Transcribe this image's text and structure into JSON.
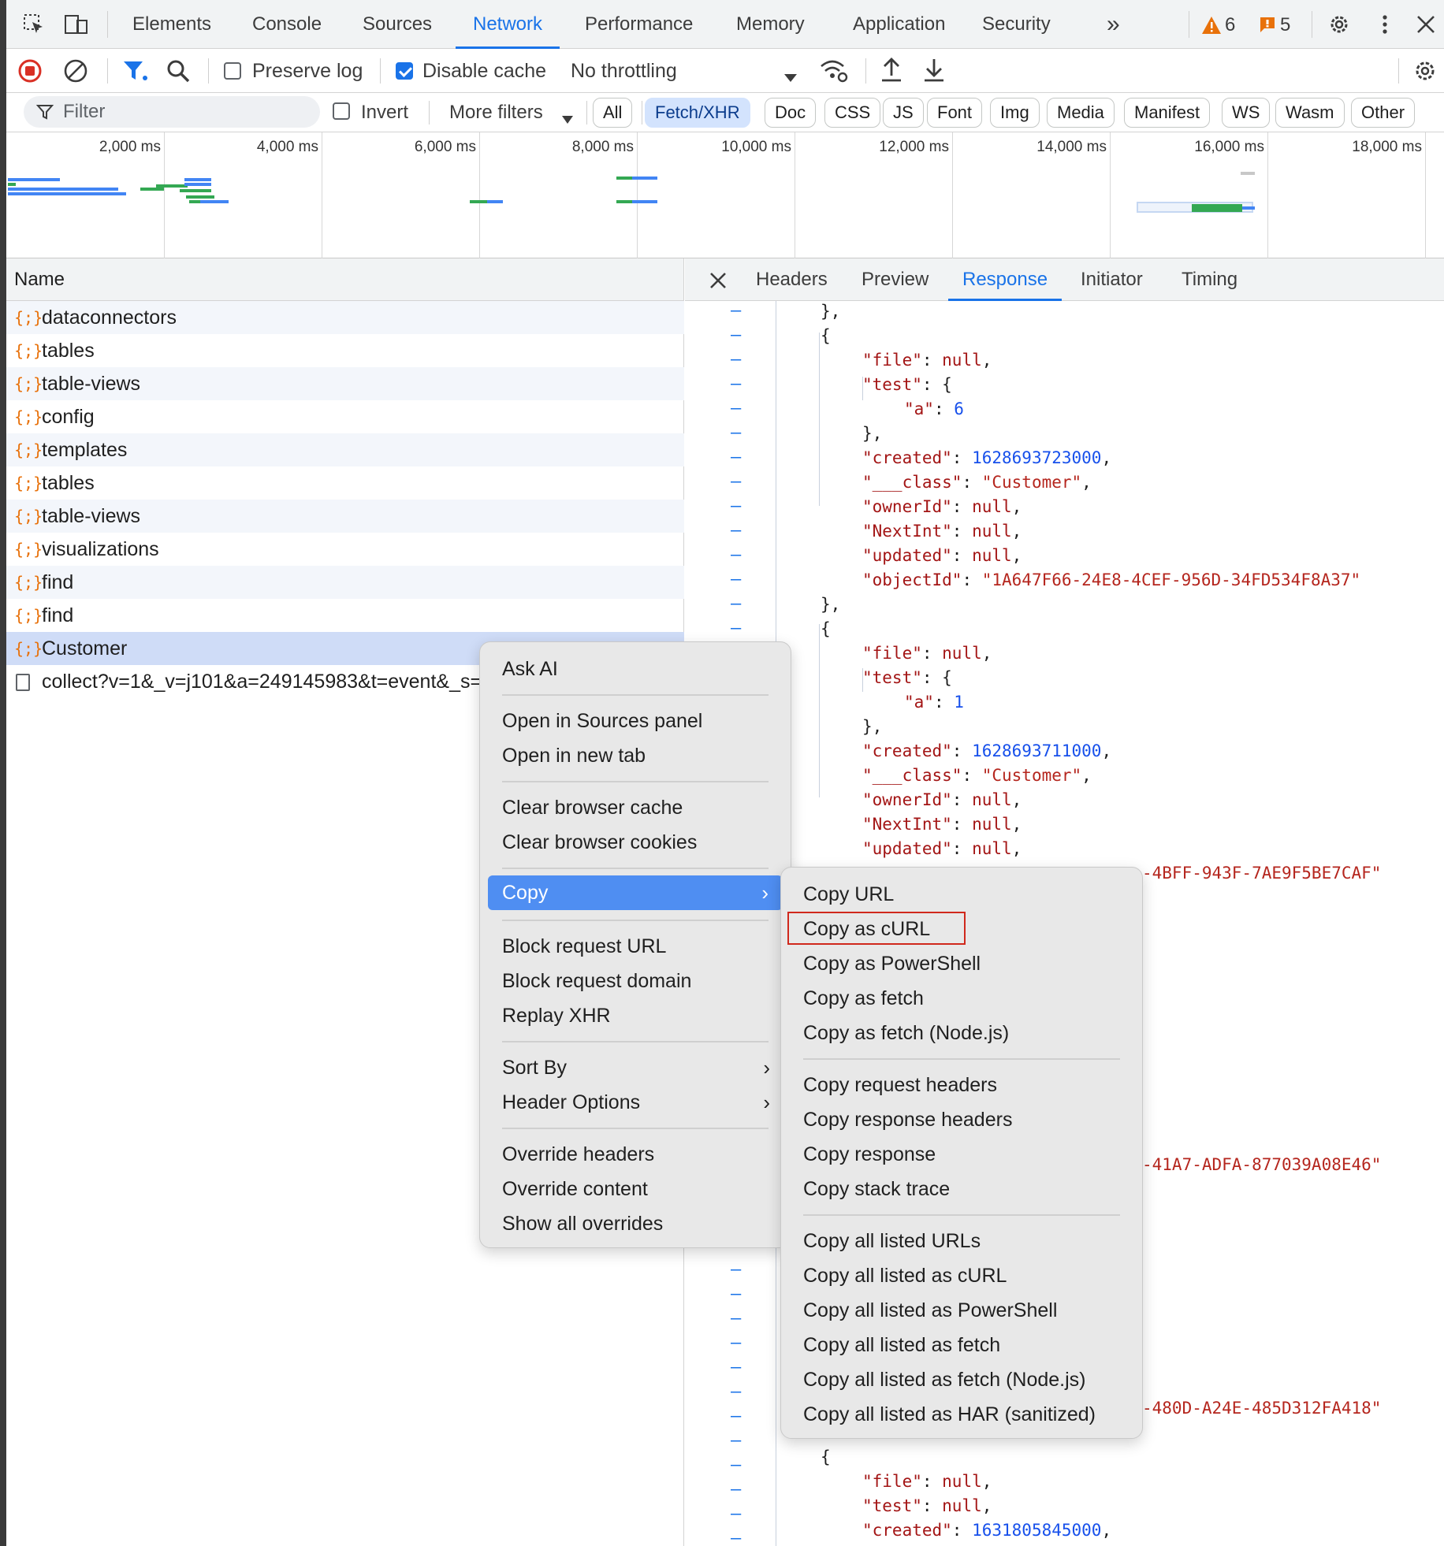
{
  "topbar": {
    "tabs": [
      "Elements",
      "Console",
      "Sources",
      "Network",
      "Performance",
      "Memory",
      "Application",
      "Security"
    ],
    "active_tab": "Network",
    "more_tabs": "»",
    "warnings_count": "6",
    "issues_count": "5"
  },
  "toolbar": {
    "preserve_log": "Preserve log",
    "preserve_log_checked": false,
    "disable_cache": "Disable cache",
    "disable_cache_checked": true,
    "throttling": "No throttling"
  },
  "filter": {
    "placeholder": "Filter",
    "invert": "Invert",
    "more_filters": "More filters",
    "types": [
      "All",
      "Fetch/XHR",
      "Doc",
      "CSS",
      "JS",
      "Font",
      "Img",
      "Media",
      "Manifest",
      "WS",
      "Wasm",
      "Other"
    ],
    "active_type": "Fetch/XHR"
  },
  "overview": {
    "ticks": [
      "2,000 ms",
      "4,000 ms",
      "6,000 ms",
      "8,000 ms",
      "10,000 ms",
      "12,000 ms",
      "14,000 ms",
      "16,000 ms",
      "18,000 ms"
    ]
  },
  "requests": {
    "header": "Name",
    "rows": [
      {
        "name": "dataconnectors",
        "type": "xhr"
      },
      {
        "name": "tables",
        "type": "xhr"
      },
      {
        "name": "table-views",
        "type": "xhr"
      },
      {
        "name": "config",
        "type": "xhr"
      },
      {
        "name": "templates",
        "type": "xhr"
      },
      {
        "name": "tables",
        "type": "xhr"
      },
      {
        "name": "table-views",
        "type": "xhr"
      },
      {
        "name": "visualizations",
        "type": "xhr"
      },
      {
        "name": "find",
        "type": "xhr"
      },
      {
        "name": "find",
        "type": "xhr"
      },
      {
        "name": "Customer",
        "type": "xhr",
        "selected": true
      },
      {
        "name": "collect?v=1&_v=j101&a=249145983&t=event&_s=",
        "type": "doc"
      }
    ]
  },
  "details": {
    "tabs": [
      "Headers",
      "Preview",
      "Response",
      "Initiator",
      "Timing"
    ],
    "active_tab": "Response",
    "code": {
      "l1": "},",
      "l2": "{",
      "file_key": "\"file\"",
      "null": "null",
      "test_key": "\"test\"",
      "a_key": "\"a\"",
      "a1": "6",
      "a2": "1",
      "created_key": "\"created\"",
      "created1": "1628693723000",
      "created2": "1628693711000",
      "created3": "1631805845000",
      "class_key": "\"___class\"",
      "class_val": "\"Customer\"",
      "owner_key": "\"ownerId\"",
      "next_key": "\"NextInt\"",
      "updated_key": "\"updated\"",
      "objectid_key": "\"objectId\"",
      "objectid1": "\"1A647F66-24E8-4CEF-956D-34FD534F8A37\"",
      "frag1": "-4BFF-943F-7AE9F5BE7CAF\"",
      "frag2": "-41A7-ADFA-877039A08E46\"",
      "frag3": "-480D-A24E-485D312FA418\""
    }
  },
  "context_menu": {
    "items": [
      "Ask AI",
      "Open in Sources panel",
      "Open in new tab",
      "Clear browser cache",
      "Clear browser cookies",
      "Copy",
      "Block request URL",
      "Block request domain",
      "Replay XHR",
      "Sort By",
      "Header Options",
      "Override headers",
      "Override content",
      "Show all overrides"
    ],
    "highlighted": "Copy"
  },
  "copy_submenu": {
    "items": [
      "Copy URL",
      "Copy as cURL",
      "Copy as PowerShell",
      "Copy as fetch",
      "Copy as fetch (Node.js)",
      "Copy request headers",
      "Copy response headers",
      "Copy response",
      "Copy stack trace",
      "Copy all listed URLs",
      "Copy all listed as cURL",
      "Copy all listed as PowerShell",
      "Copy all listed as fetch",
      "Copy all listed as fetch (Node.js)",
      "Copy all listed as HAR (sanitized)"
    ],
    "boxed": "Copy as cURL"
  },
  "colors": {
    "accent": "#1a73e8",
    "menu_highlight": "#4f8ef2",
    "red_box": "#d0281c",
    "xhr_icon": "#e8710a",
    "waterfall_blue": "#4285f4",
    "waterfall_green": "#34a853"
  }
}
